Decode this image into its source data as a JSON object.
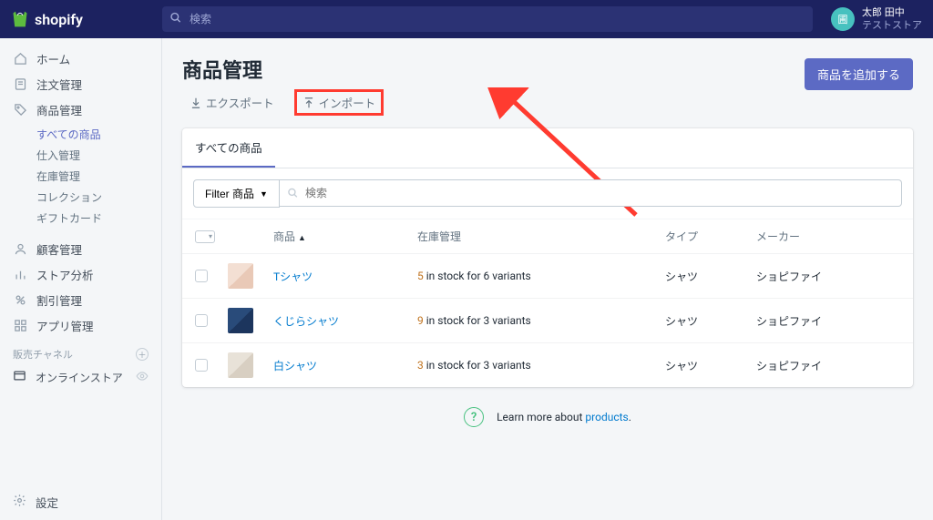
{
  "topbar": {
    "brand": "shopify",
    "search_placeholder": "検索",
    "user_name": "太郎 田中",
    "store_name": "テストストア",
    "avatar_text": "圃"
  },
  "sidebar": {
    "home": "ホーム",
    "orders": "注文管理",
    "products": "商品管理",
    "sub": {
      "all": "すべての商品",
      "transfers": "仕入管理",
      "inventory": "在庫管理",
      "collections": "コレクション",
      "giftcards": "ギフトカード"
    },
    "customers": "顧客管理",
    "analytics": "ストア分析",
    "discounts": "割引管理",
    "apps": "アプリ管理",
    "channels_label": "販売チャネル",
    "online_store": "オンラインストア",
    "settings": "設定"
  },
  "page": {
    "title": "商品管理",
    "export_label": "エクスポート",
    "import_label": "インポート",
    "add_product": "商品を追加する"
  },
  "tabs": {
    "all_products": "すべての商品"
  },
  "filter": {
    "button_label": "Filter 商品",
    "search_placeholder": "検索"
  },
  "table": {
    "headers": {
      "product": "商品",
      "inventory": "在庫管理",
      "type": "タイプ",
      "vendor": "メーカー"
    },
    "rows": [
      {
        "thumb_class": "a",
        "name": "Tシャツ",
        "stock_num": "5",
        "stock_rest": " in stock for 6 variants",
        "type": "シャツ",
        "vendor": "ショピファイ"
      },
      {
        "thumb_class": "b",
        "name": "くじらシャツ",
        "stock_num": "9",
        "stock_rest": " in stock for 3 variants",
        "type": "シャツ",
        "vendor": "ショピファイ"
      },
      {
        "thumb_class": "c",
        "name": "白シャツ",
        "stock_num": "3",
        "stock_rest": " in stock for 3 variants",
        "type": "シャツ",
        "vendor": "ショピファイ"
      }
    ]
  },
  "learn": {
    "prefix": "Learn more about ",
    "link": "products",
    "suffix": "."
  }
}
